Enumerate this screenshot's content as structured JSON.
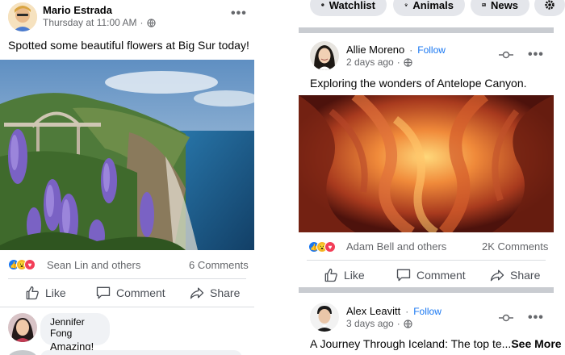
{
  "left_post": {
    "author": "Mario Estrada",
    "time": "Thursday at 11:00 AM",
    "text": "Spotted some beautiful flowers at Big Sur today!",
    "reactions_text": "Sean Lin and others",
    "comments_count": "6 Comments",
    "actions": {
      "like": "Like",
      "comment": "Comment",
      "share": "Share"
    },
    "comment": {
      "author": "Jennifer Fong",
      "text": "Amazing!"
    }
  },
  "chips": [
    "Watchlist",
    "Animals",
    "News"
  ],
  "right_post_1": {
    "author": "Allie Moreno",
    "follow": "Follow",
    "time": "2 days ago",
    "text": "Exploring the wonders of Antelope Canyon.",
    "reactions_text": "Adam Bell and others",
    "comments_count": "2K Comments",
    "actions": {
      "like": "Like",
      "comment": "Comment",
      "share": "Share"
    }
  },
  "right_post_2": {
    "author": "Alex Leavitt",
    "follow": "Follow",
    "time": "3 days ago",
    "text": "A Journey Through Iceland: The top te...",
    "see_more": "See More"
  },
  "icons": [
    "globe-icon",
    "more-icon",
    "like-icon",
    "comment-icon",
    "share-icon",
    "watchlist-icon",
    "paw-icon",
    "news-icon",
    "settings-icon",
    "pin-icon"
  ],
  "colors": {
    "link": "#1877f2",
    "like_blue": "#1877f2",
    "love_red": "#f33e58",
    "haha_yellow": "#f7b928"
  }
}
